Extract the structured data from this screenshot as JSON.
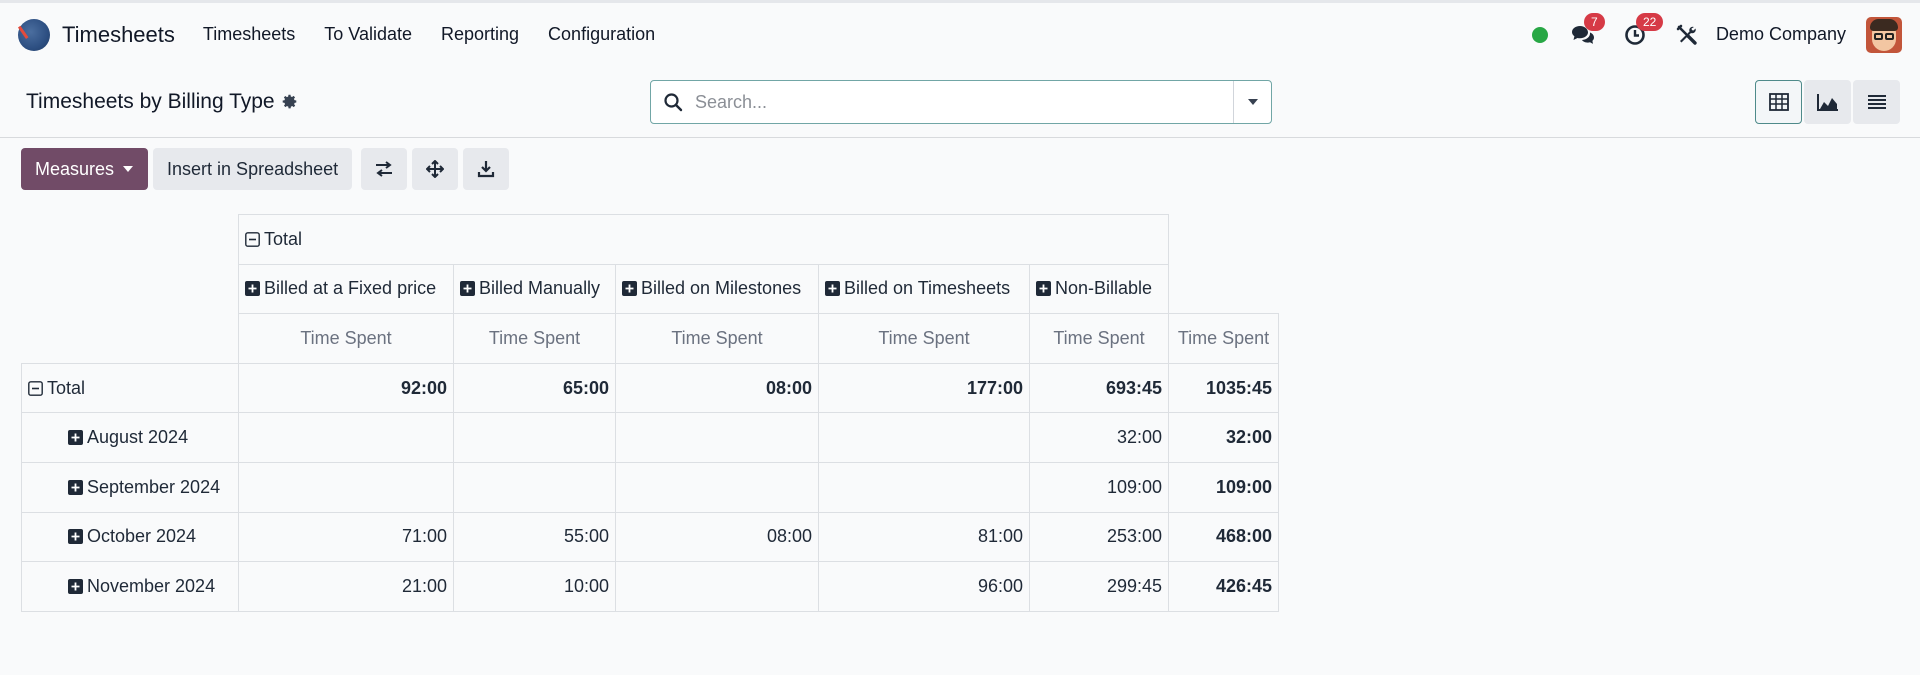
{
  "nav": {
    "app_name": "Timesheets",
    "menu": [
      "Timesheets",
      "To Validate",
      "Reporting",
      "Configuration"
    ],
    "messages_count": "7",
    "activities_count": "22",
    "company": "Demo Company",
    "status_color": "#28a745"
  },
  "control": {
    "title": "Timesheets by Billing Type",
    "search_placeholder": "Search..."
  },
  "toolbar": {
    "measures_label": "Measures",
    "insert_label": "Insert in Spreadsheet"
  },
  "pivot": {
    "col_total_label": "Total",
    "col_groups": [
      "Billed at a Fixed price",
      "Billed Manually",
      "Billed on Milestones",
      "Billed on Timesheets",
      "Non-Billable"
    ],
    "measure_label": "Time Spent",
    "row_total_label": "Total",
    "total_row": [
      "92:00",
      "65:00",
      "08:00",
      "177:00",
      "693:45",
      "1035:45"
    ],
    "rows": [
      {
        "label": "August 2024",
        "cells": [
          "",
          "",
          "",
          "",
          "32:00",
          "32:00"
        ]
      },
      {
        "label": "September 2024",
        "cells": [
          "",
          "",
          "",
          "",
          "109:00",
          "109:00"
        ]
      },
      {
        "label": "October 2024",
        "cells": [
          "71:00",
          "55:00",
          "08:00",
          "81:00",
          "253:00",
          "468:00"
        ]
      },
      {
        "label": "November 2024",
        "cells": [
          "21:00",
          "10:00",
          "",
          "96:00",
          "299:45",
          "426:45"
        ]
      }
    ]
  },
  "colors": {
    "primary": "#714b67",
    "badge": "#d63a46",
    "accent_border": "#71a6a6"
  }
}
